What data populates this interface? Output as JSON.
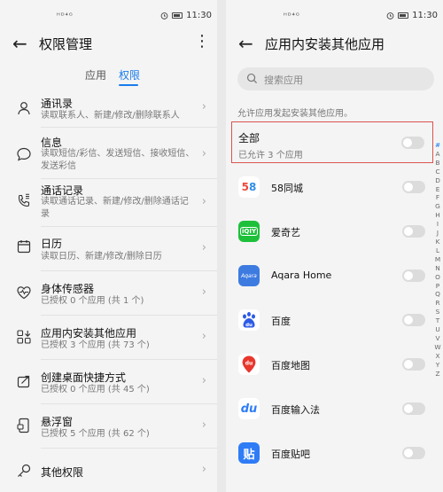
{
  "left_screen": {
    "status": {
      "time": "11:30",
      "signal": "ᴴᴰ⁴ᴳ"
    },
    "title": "权限管理",
    "tabs": [
      {
        "label": "应用"
      },
      {
        "label": "权限"
      }
    ],
    "permissions": [
      {
        "icon": "person-icon",
        "title": "通讯录",
        "subtitle": "读取联系人、新建/修改/删除联系人"
      },
      {
        "icon": "message-icon",
        "title": "信息",
        "subtitle": "读取短信/彩信、发送短信、接收短信、发送彩信"
      },
      {
        "icon": "call-log-icon",
        "title": "通话记录",
        "subtitle": "读取通话记录、新建/修改/删除通话记录"
      },
      {
        "icon": "calendar-icon",
        "title": "日历",
        "subtitle": "读取日历、新建/修改/删除日历"
      },
      {
        "icon": "body-sensor-icon",
        "title": "身体传感器",
        "subtitle": "已授权 0 个应用 (共 1 个)"
      },
      {
        "icon": "install-apps-icon",
        "title": "应用内安装其他应用",
        "subtitle": "已授权 3 个应用 (共 73 个)"
      },
      {
        "icon": "shortcut-icon",
        "title": "创建桌面快捷方式",
        "subtitle": "已授权 0 个应用 (共 45 个)"
      },
      {
        "icon": "floating-window-icon",
        "title": "悬浮窗",
        "subtitle": "已授权 5 个应用 (共 62 个)"
      },
      {
        "icon": "key-icon",
        "title": "其他权限",
        "subtitle": ""
      }
    ]
  },
  "right_screen": {
    "status": {
      "time": "11:30",
      "signal": "ᴴᴰ⁴ᴳ"
    },
    "title": "应用内安装其他应用",
    "search_placeholder": "搜索应用",
    "hint": "允许应用发起安装其他应用。",
    "all": {
      "title": "全部",
      "subtitle": "已允许 3 个应用",
      "enabled": false
    },
    "apps": [
      {
        "name": "58同城",
        "icon_text": "58",
        "color": "#ffffff",
        "enabled": false
      },
      {
        "name": "爱奇艺",
        "icon_text": "iQIY",
        "color": "#1ec03a",
        "enabled": false
      },
      {
        "name": "Aqara Home",
        "icon_text": "Aqara",
        "color": "#3d7be0",
        "enabled": false
      },
      {
        "name": "百度",
        "icon_text": "du",
        "color": "#ffffff",
        "enabled": false
      },
      {
        "name": "百度地图",
        "icon_text": "du",
        "color": "#ffffff",
        "enabled": false
      },
      {
        "name": "百度输入法",
        "icon_text": "du",
        "color": "#ffffff",
        "enabled": false
      },
      {
        "name": "百度贴吧",
        "icon_text": "贴",
        "color": "#2e7cf6",
        "enabled": false
      }
    ],
    "alphabet_index": [
      "#",
      "A",
      "B",
      "C",
      "D",
      "E",
      "F",
      "G",
      "H",
      "I",
      "J",
      "K",
      "L",
      "M",
      "N",
      "O",
      "P",
      "Q",
      "R",
      "S",
      "T",
      "U",
      "V",
      "W",
      "X",
      "Y",
      "Z"
    ]
  },
  "colors": {
    "accent": "#1a7bea",
    "highlight_border": "#d9534f"
  }
}
